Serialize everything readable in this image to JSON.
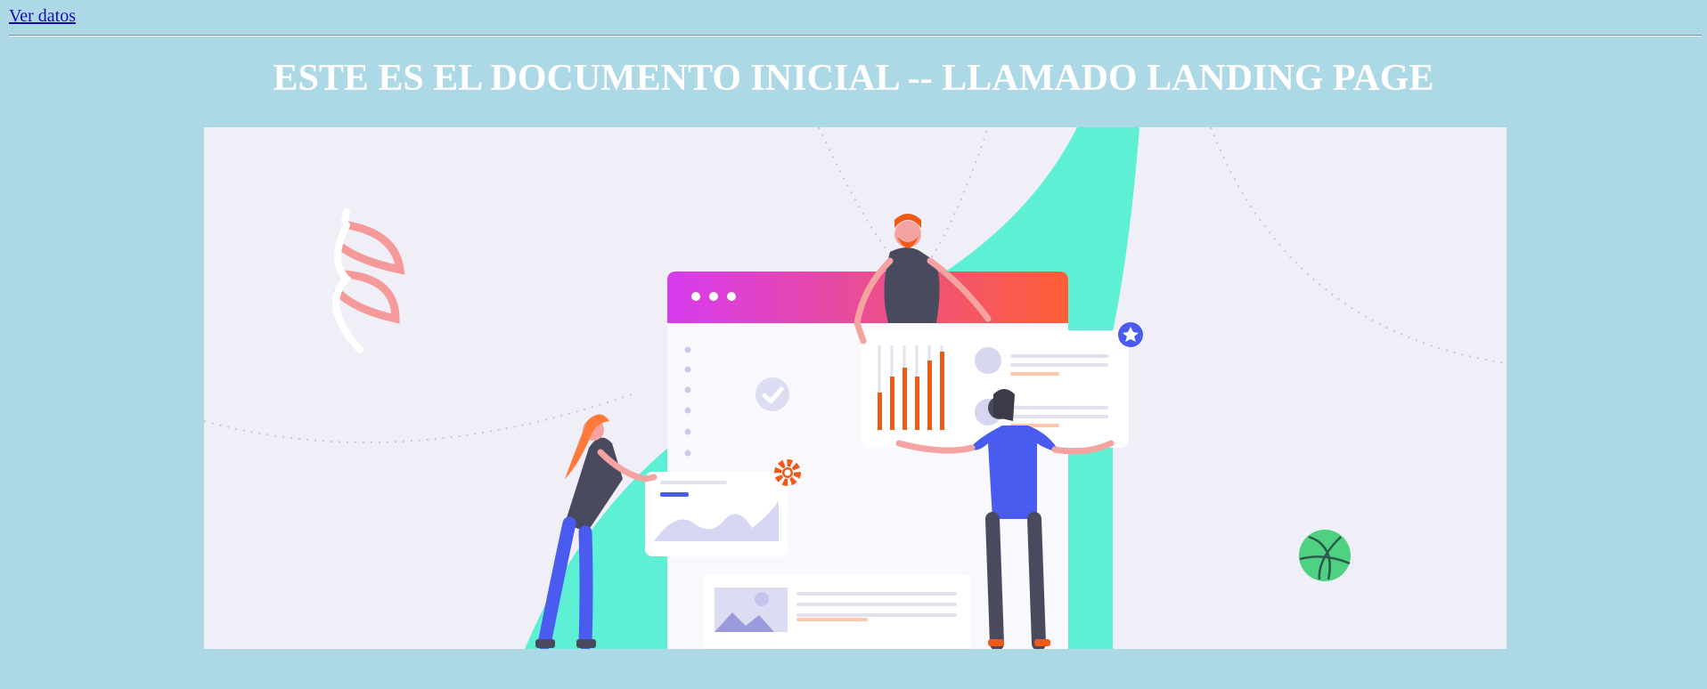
{
  "nav": {
    "link_label": "Ver datos"
  },
  "header": {
    "title": "ESTE ES EL DOCUMENTO INICIAL -- LLAMADO LANDING PAGE"
  },
  "hero": {
    "illustration": "team-building-dashboard-illustration",
    "colors": {
      "background": "#f0eff8",
      "mint": "#5ef0d4",
      "gradient_start": "#d63bf0",
      "gradient_end": "#ff5f36",
      "accent_blue": "#4a5cf0",
      "accent_orange": "#f05a18"
    }
  }
}
